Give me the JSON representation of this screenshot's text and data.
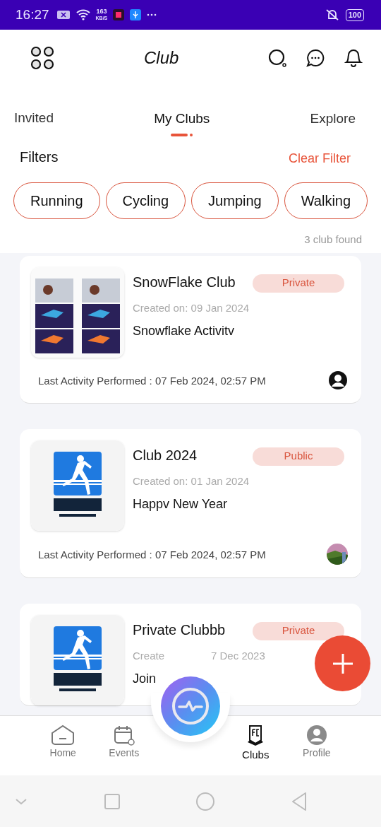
{
  "status_bar": {
    "time": "16:27",
    "speed_value": "163",
    "speed_unit": "KB/S",
    "battery": "100"
  },
  "header": {
    "title": "Club"
  },
  "tabs": [
    {
      "label": "Invited",
      "selected": false
    },
    {
      "label": "My Clubs",
      "selected": true
    },
    {
      "label": "Explore",
      "selected": false
    }
  ],
  "filters": {
    "label": "Filters",
    "clear": "Clear Filter"
  },
  "chips": [
    {
      "label": "Running",
      "selected": false
    },
    {
      "label": "Cycling",
      "selected": false
    },
    {
      "label": "Jumping",
      "selected": false
    },
    {
      "label": "Walking",
      "selected": false
    }
  ],
  "result_count": "3 club found",
  "clubs": [
    {
      "name": "SnowFlake Club",
      "privacy": "Private",
      "created": "Created on: 09 Jan 2024",
      "description": "Snowflake Activitv",
      "last_activity": "Last Activity Performed : 07 Feb 2024, 02:57 PM",
      "thumb": {
        "kind": "screens"
      },
      "avatar": {
        "kind": "silhouette"
      }
    },
    {
      "name": "Club 2024",
      "privacy": "Public",
      "created": "Created on: 01 Jan 2024",
      "description": "Happv New Year",
      "last_activity": "Last Activity Performed : 07 Feb 2024, 02:57 PM",
      "thumb": {
        "kind": "runner"
      }
    },
    {
      "name": "Private Clubbb",
      "privacy": "Private",
      "created": "Create",
      "created_after_gap": "7 Dec 2023",
      "description": "Join",
      "thumb": {
        "kind": "runner"
      }
    }
  ],
  "bottom_nav": [
    {
      "label": "Home",
      "kind": "home",
      "selected": false
    },
    {
      "label": "Events",
      "kind": "calendar",
      "selected": false
    },
    {
      "label": "Clubs",
      "kind": "club",
      "selected": true
    },
    {
      "label": "Profile",
      "kind": "profile",
      "selected": false
    }
  ]
}
